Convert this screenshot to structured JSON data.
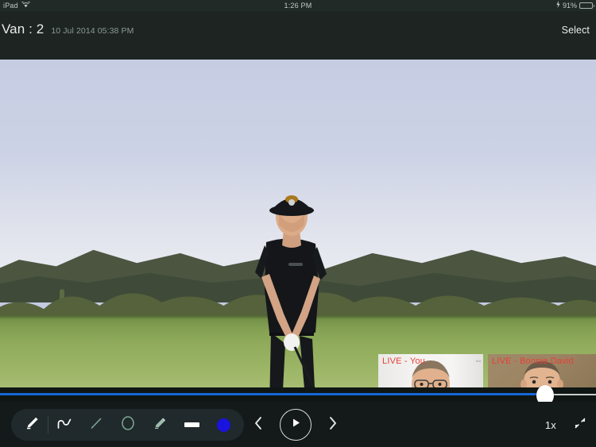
{
  "status_bar": {
    "device": "iPad",
    "wifi_icon": "wifi-icon",
    "time": "1:26 PM",
    "charging_icon": "lightning-bolt-icon",
    "battery_percent": "91%",
    "battery_icon": "battery-icon"
  },
  "header": {
    "title": "Van : 2",
    "date": "10 Jul 2014 05:38 PM",
    "select_label": "Select"
  },
  "video": {
    "scene_description": "golfer at address on desert golf course",
    "pips": [
      {
        "label": "LIVE - You",
        "name": "pip-local-video",
        "label_color": "#e8403a",
        "tag": "Vid"
      },
      {
        "label": "LIVE - Bonnie David",
        "name": "pip-remote-video",
        "label_color": "#e8403a"
      }
    ]
  },
  "seek_bar": {
    "progress_percent": 91,
    "filled_color": "#1467d8",
    "track_color": "#c9cdca",
    "thumb_name": "seek-thumb"
  },
  "toolbar": {
    "tools": [
      {
        "name": "pencil-tool",
        "icon": "pencil-icon",
        "active": true
      },
      {
        "name": "curve-tool",
        "icon": "curve-icon",
        "active": false
      },
      {
        "name": "line-tool",
        "icon": "line-icon",
        "active": false
      },
      {
        "name": "circle-tool",
        "icon": "circle-icon",
        "active": false
      },
      {
        "name": "eraser-tool",
        "icon": "eraser-icon",
        "active": false
      },
      {
        "name": "stroke-width-tool",
        "icon": "thick-line-icon",
        "active": false
      },
      {
        "name": "color-swatch-tool",
        "icon": "color-circle-icon",
        "color": "#1a13de"
      }
    ],
    "transport": {
      "previous_icon": "chevron-left-icon",
      "play_icon": "play-icon",
      "next_icon": "chevron-right-icon"
    },
    "speed_label": "1x",
    "collapse_icon": "collapse-arrows-icon"
  },
  "colors": {
    "chrome_dark": "#14191a",
    "title_bar": "#1d2422",
    "accent_blue": "#1467d8",
    "live_red": "#e8403a",
    "swatch_blue": "#1a13de"
  }
}
